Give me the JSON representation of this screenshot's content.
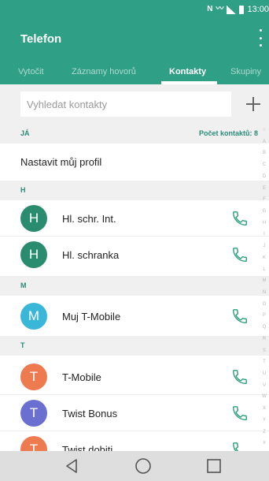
{
  "status_bar": {
    "time": "13:00",
    "icons": [
      "nfc-icon",
      "vibrate-icon",
      "signal-icon",
      "battery-icon"
    ]
  },
  "app": {
    "title": "Telefon",
    "menu_icon": "more-vertical-icon"
  },
  "tabs": [
    {
      "label": "Vytočit",
      "active": false
    },
    {
      "label": "Záznamy hovorů",
      "active": false
    },
    {
      "label": "Kontakty",
      "active": true
    },
    {
      "label": "Skupiny",
      "active": false
    }
  ],
  "search": {
    "placeholder": "Vyhledat kontakty",
    "value": "",
    "add_icon": "plus-icon"
  },
  "me_section": {
    "label": "JÁ",
    "count_label": "Počet kontaktů: 8"
  },
  "profile": {
    "label": "Nastavit můj profil"
  },
  "groups": [
    {
      "header": "H",
      "contacts": [
        {
          "initial": "H",
          "name": "Hl. schr. Int.",
          "color": "#2a8c6e"
        },
        {
          "initial": "H",
          "name": "Hl. schranka",
          "color": "#2a8c6e"
        }
      ]
    },
    {
      "header": "M",
      "contacts": [
        {
          "initial": "M",
          "name": "Muj T-Mobile",
          "color": "#3ab6d8"
        }
      ]
    },
    {
      "header": "T",
      "contacts": [
        {
          "initial": "T",
          "name": "T-Mobile",
          "color": "#ee7a4f"
        },
        {
          "initial": "T",
          "name": "Twist Bonus",
          "color": "#6b6fcf"
        },
        {
          "initial": "T",
          "name": "Twist dobiti",
          "color": "#ee7a4f"
        }
      ]
    }
  ],
  "index_letters": [
    "☆",
    "A",
    "B",
    "C",
    "D",
    "E",
    "F",
    "G",
    "H",
    "I",
    "J",
    "K",
    "L",
    "M",
    "N",
    "O",
    "P",
    "Q",
    "R",
    "S",
    "T",
    "U",
    "V",
    "W",
    "X",
    "Y",
    "Z",
    "#"
  ],
  "colors": {
    "accent": "#2f9f86",
    "call_icon": "#2a9d7a"
  },
  "nav": {
    "back_icon": "back-triangle-icon",
    "home_icon": "home-circle-icon",
    "recents_icon": "recents-square-icon"
  }
}
